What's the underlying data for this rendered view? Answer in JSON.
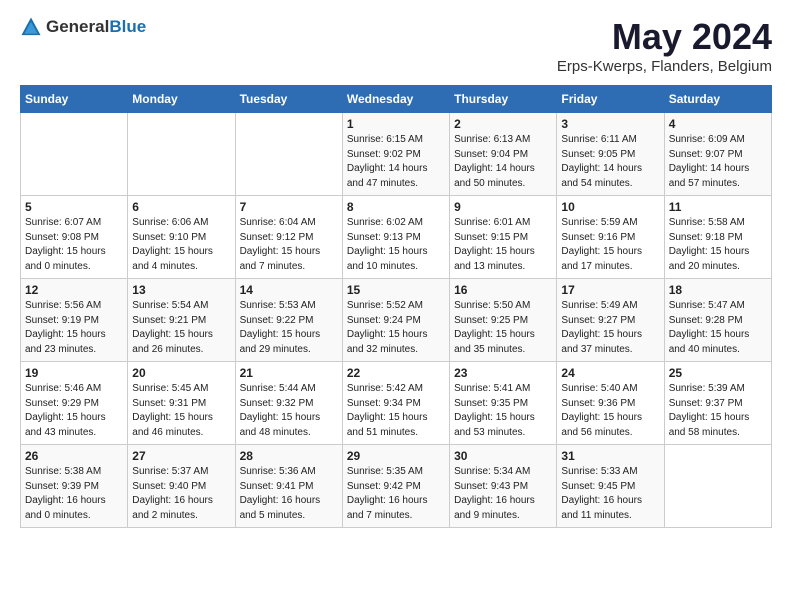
{
  "header": {
    "logo_general": "General",
    "logo_blue": "Blue",
    "title": "May 2024",
    "subtitle": "Erps-Kwerps, Flanders, Belgium"
  },
  "days_of_week": [
    "Sunday",
    "Monday",
    "Tuesday",
    "Wednesday",
    "Thursday",
    "Friday",
    "Saturday"
  ],
  "weeks": [
    [
      {
        "day": "",
        "sunrise": "",
        "sunset": "",
        "daylight": ""
      },
      {
        "day": "",
        "sunrise": "",
        "sunset": "",
        "daylight": ""
      },
      {
        "day": "",
        "sunrise": "",
        "sunset": "",
        "daylight": ""
      },
      {
        "day": "1",
        "sunrise": "Sunrise: 6:15 AM",
        "sunset": "Sunset: 9:02 PM",
        "daylight": "Daylight: 14 hours and 47 minutes."
      },
      {
        "day": "2",
        "sunrise": "Sunrise: 6:13 AM",
        "sunset": "Sunset: 9:04 PM",
        "daylight": "Daylight: 14 hours and 50 minutes."
      },
      {
        "day": "3",
        "sunrise": "Sunrise: 6:11 AM",
        "sunset": "Sunset: 9:05 PM",
        "daylight": "Daylight: 14 hours and 54 minutes."
      },
      {
        "day": "4",
        "sunrise": "Sunrise: 6:09 AM",
        "sunset": "Sunset: 9:07 PM",
        "daylight": "Daylight: 14 hours and 57 minutes."
      }
    ],
    [
      {
        "day": "5",
        "sunrise": "Sunrise: 6:07 AM",
        "sunset": "Sunset: 9:08 PM",
        "daylight": "Daylight: 15 hours and 0 minutes."
      },
      {
        "day": "6",
        "sunrise": "Sunrise: 6:06 AM",
        "sunset": "Sunset: 9:10 PM",
        "daylight": "Daylight: 15 hours and 4 minutes."
      },
      {
        "day": "7",
        "sunrise": "Sunrise: 6:04 AM",
        "sunset": "Sunset: 9:12 PM",
        "daylight": "Daylight: 15 hours and 7 minutes."
      },
      {
        "day": "8",
        "sunrise": "Sunrise: 6:02 AM",
        "sunset": "Sunset: 9:13 PM",
        "daylight": "Daylight: 15 hours and 10 minutes."
      },
      {
        "day": "9",
        "sunrise": "Sunrise: 6:01 AM",
        "sunset": "Sunset: 9:15 PM",
        "daylight": "Daylight: 15 hours and 13 minutes."
      },
      {
        "day": "10",
        "sunrise": "Sunrise: 5:59 AM",
        "sunset": "Sunset: 9:16 PM",
        "daylight": "Daylight: 15 hours and 17 minutes."
      },
      {
        "day": "11",
        "sunrise": "Sunrise: 5:58 AM",
        "sunset": "Sunset: 9:18 PM",
        "daylight": "Daylight: 15 hours and 20 minutes."
      }
    ],
    [
      {
        "day": "12",
        "sunrise": "Sunrise: 5:56 AM",
        "sunset": "Sunset: 9:19 PM",
        "daylight": "Daylight: 15 hours and 23 minutes."
      },
      {
        "day": "13",
        "sunrise": "Sunrise: 5:54 AM",
        "sunset": "Sunset: 9:21 PM",
        "daylight": "Daylight: 15 hours and 26 minutes."
      },
      {
        "day": "14",
        "sunrise": "Sunrise: 5:53 AM",
        "sunset": "Sunset: 9:22 PM",
        "daylight": "Daylight: 15 hours and 29 minutes."
      },
      {
        "day": "15",
        "sunrise": "Sunrise: 5:52 AM",
        "sunset": "Sunset: 9:24 PM",
        "daylight": "Daylight: 15 hours and 32 minutes."
      },
      {
        "day": "16",
        "sunrise": "Sunrise: 5:50 AM",
        "sunset": "Sunset: 9:25 PM",
        "daylight": "Daylight: 15 hours and 35 minutes."
      },
      {
        "day": "17",
        "sunrise": "Sunrise: 5:49 AM",
        "sunset": "Sunset: 9:27 PM",
        "daylight": "Daylight: 15 hours and 37 minutes."
      },
      {
        "day": "18",
        "sunrise": "Sunrise: 5:47 AM",
        "sunset": "Sunset: 9:28 PM",
        "daylight": "Daylight: 15 hours and 40 minutes."
      }
    ],
    [
      {
        "day": "19",
        "sunrise": "Sunrise: 5:46 AM",
        "sunset": "Sunset: 9:29 PM",
        "daylight": "Daylight: 15 hours and 43 minutes."
      },
      {
        "day": "20",
        "sunrise": "Sunrise: 5:45 AM",
        "sunset": "Sunset: 9:31 PM",
        "daylight": "Daylight: 15 hours and 46 minutes."
      },
      {
        "day": "21",
        "sunrise": "Sunrise: 5:44 AM",
        "sunset": "Sunset: 9:32 PM",
        "daylight": "Daylight: 15 hours and 48 minutes."
      },
      {
        "day": "22",
        "sunrise": "Sunrise: 5:42 AM",
        "sunset": "Sunset: 9:34 PM",
        "daylight": "Daylight: 15 hours and 51 minutes."
      },
      {
        "day": "23",
        "sunrise": "Sunrise: 5:41 AM",
        "sunset": "Sunset: 9:35 PM",
        "daylight": "Daylight: 15 hours and 53 minutes."
      },
      {
        "day": "24",
        "sunrise": "Sunrise: 5:40 AM",
        "sunset": "Sunset: 9:36 PM",
        "daylight": "Daylight: 15 hours and 56 minutes."
      },
      {
        "day": "25",
        "sunrise": "Sunrise: 5:39 AM",
        "sunset": "Sunset: 9:37 PM",
        "daylight": "Daylight: 15 hours and 58 minutes."
      }
    ],
    [
      {
        "day": "26",
        "sunrise": "Sunrise: 5:38 AM",
        "sunset": "Sunset: 9:39 PM",
        "daylight": "Daylight: 16 hours and 0 minutes."
      },
      {
        "day": "27",
        "sunrise": "Sunrise: 5:37 AM",
        "sunset": "Sunset: 9:40 PM",
        "daylight": "Daylight: 16 hours and 2 minutes."
      },
      {
        "day": "28",
        "sunrise": "Sunrise: 5:36 AM",
        "sunset": "Sunset: 9:41 PM",
        "daylight": "Daylight: 16 hours and 5 minutes."
      },
      {
        "day": "29",
        "sunrise": "Sunrise: 5:35 AM",
        "sunset": "Sunset: 9:42 PM",
        "daylight": "Daylight: 16 hours and 7 minutes."
      },
      {
        "day": "30",
        "sunrise": "Sunrise: 5:34 AM",
        "sunset": "Sunset: 9:43 PM",
        "daylight": "Daylight: 16 hours and 9 minutes."
      },
      {
        "day": "31",
        "sunrise": "Sunrise: 5:33 AM",
        "sunset": "Sunset: 9:45 PM",
        "daylight": "Daylight: 16 hours and 11 minutes."
      },
      {
        "day": "",
        "sunrise": "",
        "sunset": "",
        "daylight": ""
      }
    ]
  ]
}
